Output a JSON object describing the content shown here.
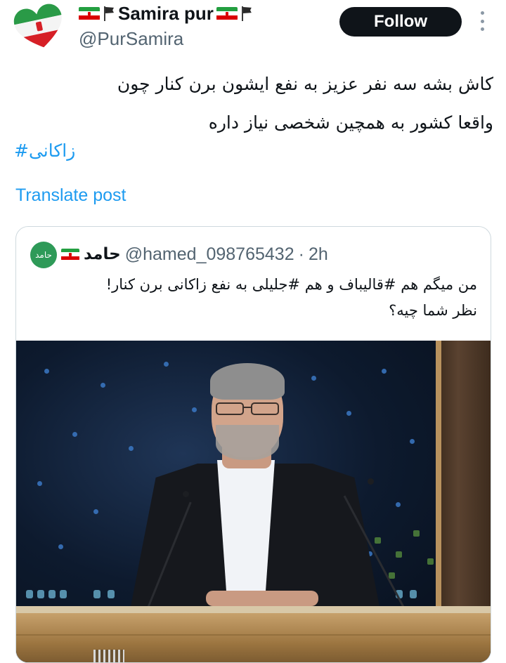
{
  "author": {
    "display_name": "Samira pur",
    "handle": "@PurSamira",
    "avatar_icon": "iran-flag-heart-avatar",
    "name_icons": [
      "iran-flag-icon",
      "black-flag-icon",
      "iran-flag-icon",
      "black-flag-icon"
    ]
  },
  "actions": {
    "follow_label": "Follow",
    "more_icon": "more-vertical-icon"
  },
  "tweet": {
    "text": "کاش بشه سه نفر عزیز به نفع ایشون برن کنار چون\nواقعا کشور به همچین شخصی نیاز داره",
    "hashtag": "زاکانی#",
    "translate_label": "Translate post"
  },
  "quote": {
    "avatar_label": "حامد",
    "display_name": "حامد",
    "handle": "@hamed_098765432",
    "separator": "·",
    "time": "2h",
    "text": "من میگم هم #قالیباف و هم #جلیلی به نفع زاکانی برن کنار!\nنظر شما چیه؟",
    "media_description": "man-at-podium-photo"
  },
  "colors": {
    "accent": "#1d9bf0",
    "text": "#0f1419",
    "secondary": "#536471",
    "follow_bg": "#0f1419",
    "border": "#cfd9de"
  }
}
